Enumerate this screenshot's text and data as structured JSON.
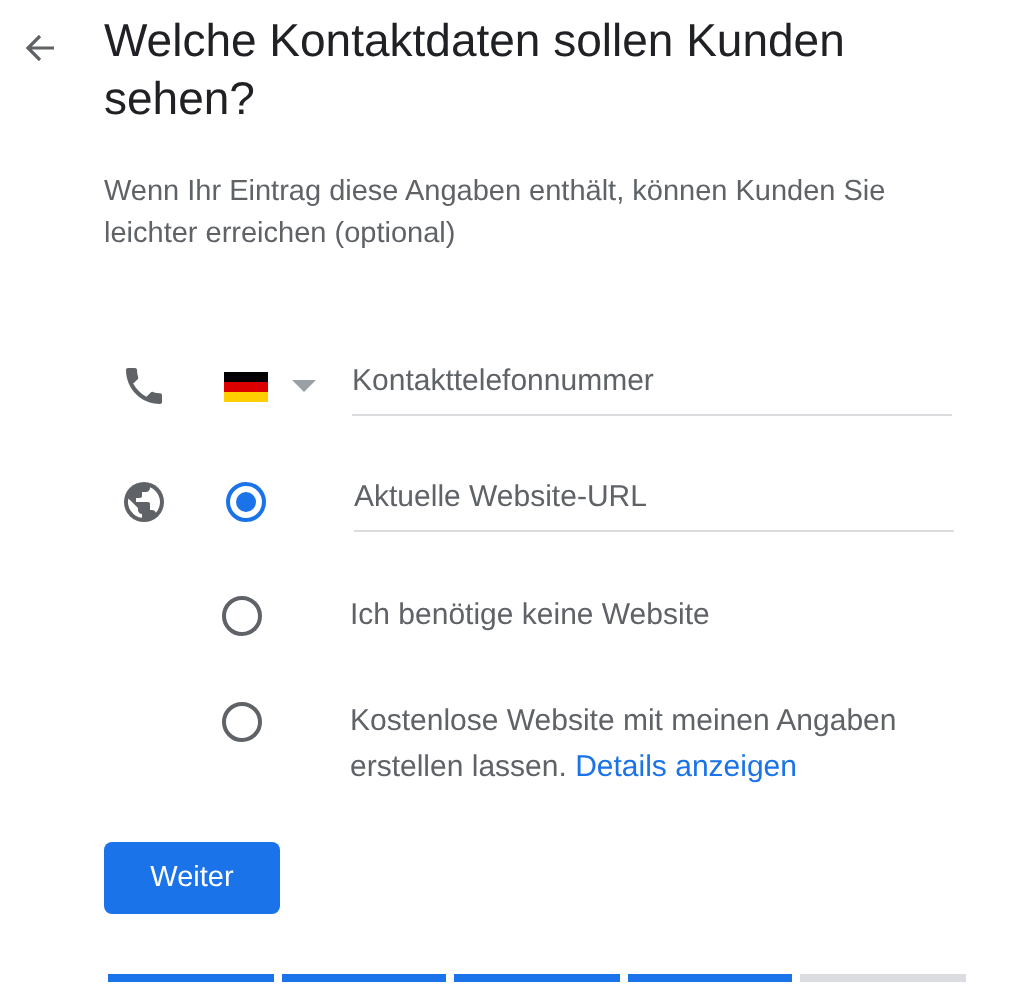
{
  "title": "Welche Kontaktdaten sollen Kunden sehen?",
  "subtitle": "Wenn Ihr Eintrag diese Angaben enthält, können Kunden Sie leichter erreichen (optional)",
  "phone": {
    "placeholder": "Kontakttelefonnummer"
  },
  "website_options": [
    {
      "kind": "field",
      "placeholder": "Aktuelle Website-URL",
      "selected": true
    },
    {
      "kind": "text",
      "label": "Ich benötige keine Website",
      "selected": false
    },
    {
      "kind": "text",
      "label": "Kostenlose Website mit meinen Angaben erstellen lassen.",
      "link": "Details anzeigen",
      "selected": false
    }
  ],
  "button": "Weiter",
  "progress": [
    {
      "complete": true
    },
    {
      "complete": true
    },
    {
      "complete": true
    },
    {
      "complete": true
    },
    {
      "complete": false
    }
  ]
}
